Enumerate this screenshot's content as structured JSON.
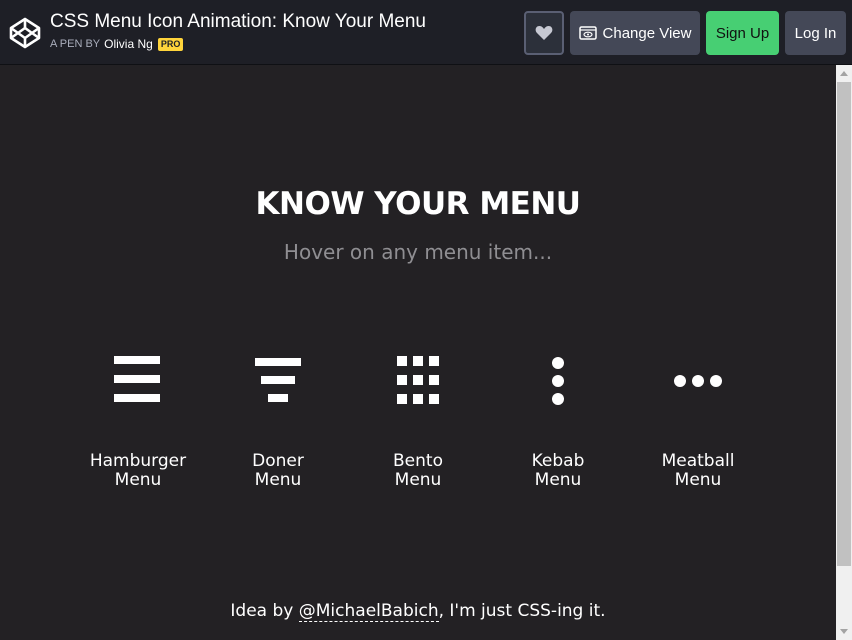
{
  "header": {
    "title": "CSS Menu Icon Animation: Know Your Menu",
    "meta_prefix": "A PEN BY",
    "author": "Olivia Ng",
    "badge": "PRO",
    "buttons": {
      "heart_icon": "heart-icon",
      "change_view": "Change View",
      "sign_up": "Sign Up",
      "log_in": "Log In"
    }
  },
  "content": {
    "title": "KNOW YOUR MENU",
    "subtitle": "Hover on any menu item...",
    "menus": [
      {
        "icon": "hamburger-icon",
        "line1": "Hamburger",
        "line2": "Menu"
      },
      {
        "icon": "doner-icon",
        "line1": "Doner",
        "line2": "Menu"
      },
      {
        "icon": "bento-icon",
        "line1": "Bento",
        "line2": "Menu"
      },
      {
        "icon": "kebab-icon",
        "line1": "Kebab",
        "line2": "Menu"
      },
      {
        "icon": "meatball-icon",
        "line1": "Meatball",
        "line2": "Menu"
      }
    ],
    "footer": {
      "prefix": "Idea by",
      "link": "@MichaelBabich",
      "suffix": ", I'm just CSS-ing it."
    }
  },
  "colors": {
    "background": "#232124",
    "header_bg": "#1e1f26",
    "signup": "#47cf73",
    "pro_badge": "#ffd43b",
    "subtitle": "#8f8e92"
  }
}
